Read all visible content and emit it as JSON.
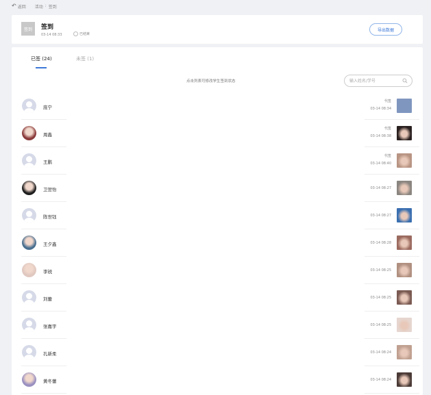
{
  "topbar": {
    "back_label": "返回",
    "crumb_1": "活动",
    "crumb_sep": ":",
    "crumb_2": "签到"
  },
  "card": {
    "badge": "签到",
    "title": "签到",
    "date": "03-14 08:33",
    "status": "已结束",
    "export_label": "导出数据"
  },
  "tabs": {
    "signed": "已签 (24)",
    "unsigned": "未签 (1)"
  },
  "hint": "点击列表可修改学生签到状态",
  "search": {
    "placeholder": "输入姓名/学号"
  },
  "students": [
    {
      "name": "庞宁",
      "tag": "代签",
      "time": "03-14 08:34",
      "avatar": "default",
      "thumb_color": "#7f96bf"
    },
    {
      "name": "周鑫",
      "tag": "代签",
      "time": "03-14 08:38",
      "avatar": "photo",
      "avatar_color": "#8a3a3a",
      "thumb_color": "#2a2020"
    },
    {
      "name": "王鹏",
      "tag": "代签",
      "time": "03-14 08:40",
      "avatar": "default",
      "thumb_color": "#b89483"
    },
    {
      "name": "卫翌怡",
      "tag": "",
      "time": "03-14 08:27",
      "avatar": "photo",
      "avatar_color": "#1e1e1e",
      "thumb_color": "#8b8580"
    },
    {
      "name": "陈世钰",
      "tag": "",
      "time": "03-14 08:27",
      "avatar": "default",
      "thumb_color": "#3a6fb0"
    },
    {
      "name": "王夕鑫",
      "tag": "",
      "time": "03-14 08:28",
      "avatar": "photo",
      "avatar_color": "#4a6f8f",
      "thumb_color": "#9b6a5f"
    },
    {
      "name": "李锐",
      "tag": "",
      "time": "03-14 08:25",
      "avatar": "photo",
      "avatar_color": "#e0c8c0",
      "thumb_color": "#b09080"
    },
    {
      "name": "刘蕾",
      "tag": "",
      "time": "03-14 08:25",
      "avatar": "default",
      "thumb_color": "#7a5a52"
    },
    {
      "name": "张嘉宇",
      "tag": "",
      "time": "03-14 08:25",
      "avatar": "default",
      "thumb_color": "#e6d6d0"
    },
    {
      "name": "孔新柔",
      "tag": "",
      "time": "03-14 08:24",
      "avatar": "default",
      "thumb_color": "#c0a090"
    },
    {
      "name": "黄冬蕾",
      "tag": "",
      "time": "03-14 08:24",
      "avatar": "photo",
      "avatar_color": "#9a90c0",
      "thumb_color": "#4a3a36"
    }
  ]
}
